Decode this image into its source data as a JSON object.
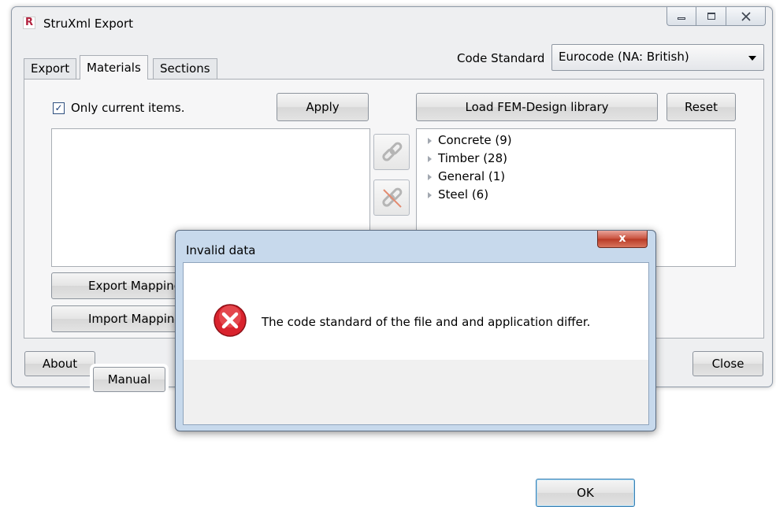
{
  "window": {
    "title": "StruXml Export",
    "app_icon_letter": "R",
    "controls": {
      "minimize": "minimize",
      "maximize": "maximize",
      "close": "close"
    }
  },
  "tabs": [
    {
      "label": "Export",
      "active": false
    },
    {
      "label": "Materials",
      "active": true
    },
    {
      "label": "Sections",
      "active": false
    }
  ],
  "code_standard": {
    "label": "Code Standard",
    "value": "Eurocode (NA: British)"
  },
  "left_panel": {
    "only_current_label": "Only current items.",
    "only_current_checked": true,
    "apply_label": "Apply",
    "export_mapping_label": "Export Mapping",
    "import_mapping_label": "Import Mapping"
  },
  "right_panel": {
    "load_library_label": "Load FEM-Design library",
    "reset_label": "Reset",
    "tree": [
      {
        "label": "Concrete",
        "count": "(9)"
      },
      {
        "label": "Timber",
        "count": "(28)"
      },
      {
        "label": "General",
        "count": "(1)"
      },
      {
        "label": "Steel",
        "count": "(6)"
      }
    ]
  },
  "footer": {
    "about_label": "About",
    "manual_label": "Manual",
    "close_label": "Close"
  },
  "dialog": {
    "title": "Invalid data",
    "close_glyph": "x",
    "message": "The code standard of the file and and application differ.",
    "ok_label": "OK",
    "error_glyph": "✕"
  },
  "colors": {
    "error_red": "#d9232d",
    "dialog_frame": "#c7d9ec",
    "window_bg": "#eeeff1"
  }
}
